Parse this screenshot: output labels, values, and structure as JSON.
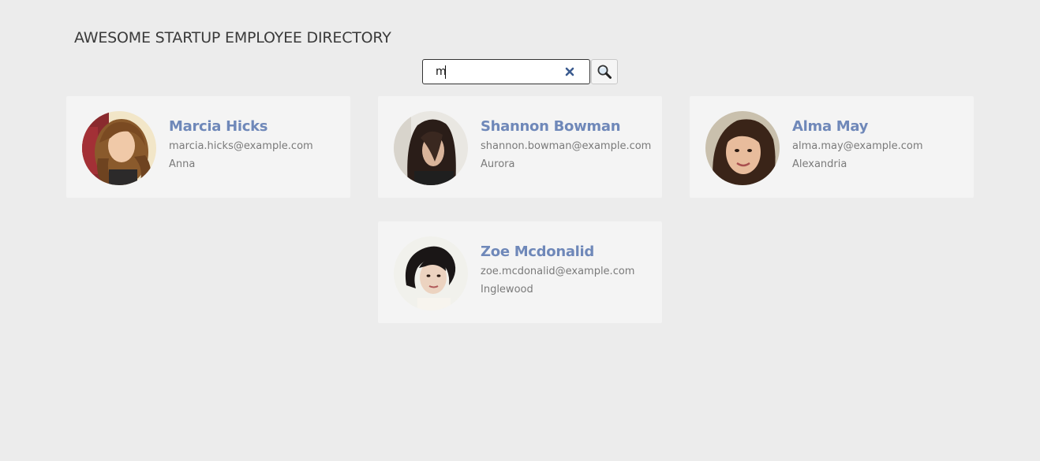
{
  "header": {
    "title": "AWESOME STARTUP EMPLOYEE DIRECTORY"
  },
  "search": {
    "value": "m",
    "clear_icon": "close-icon",
    "button_icon": "magnifier-icon"
  },
  "colors": {
    "background": "#ececec",
    "card": "#f4f4f4",
    "name": "#6f88b9",
    "detail": "#7a7a7a",
    "clear_icon": "#3b5b8f"
  },
  "employees": [
    {
      "name": "Marcia Hicks",
      "email": "marcia.hicks@example.com",
      "city": "Anna"
    },
    {
      "name": "Shannon Bowman",
      "email": "shannon.bowman@example.com",
      "city": "Aurora"
    },
    {
      "name": "Alma May",
      "email": "alma.may@example.com",
      "city": "Alexandria"
    },
    {
      "name": "Zoe Mcdonalid",
      "email": "zoe.mcdonalid@example.com",
      "city": "Inglewood"
    }
  ]
}
